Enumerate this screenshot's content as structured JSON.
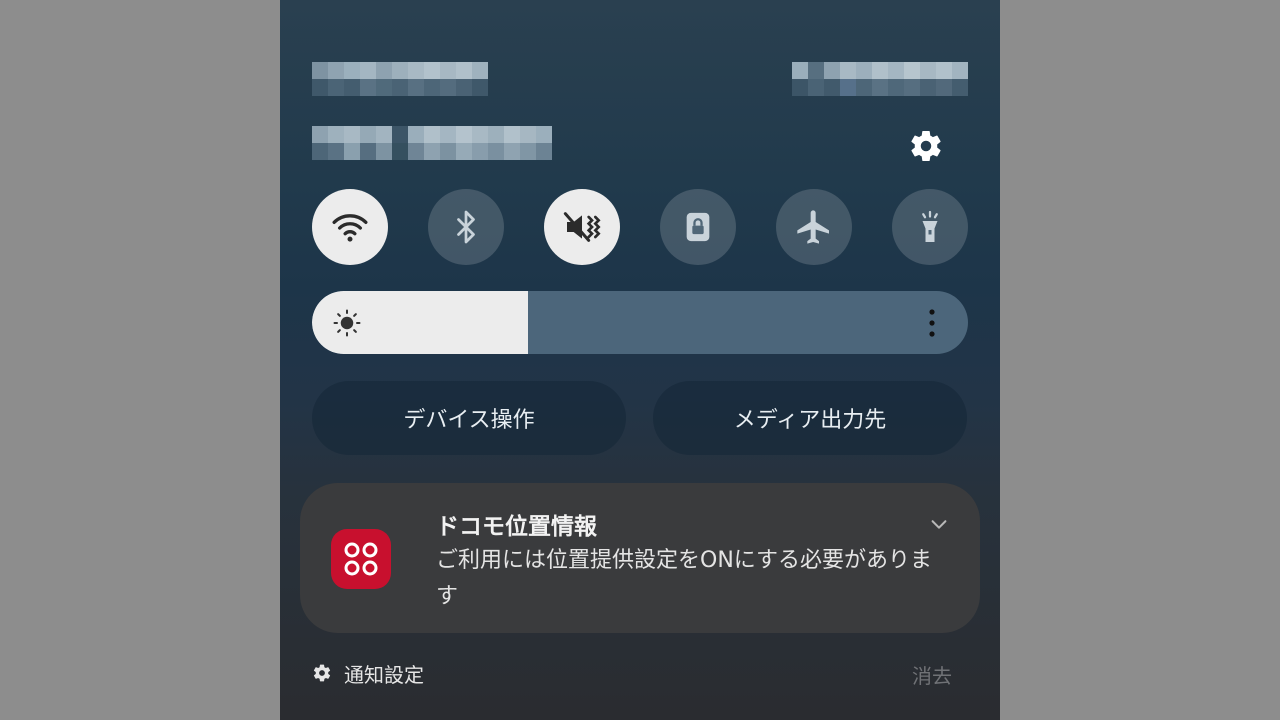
{
  "quick_settings": {
    "tiles": [
      {
        "name": "wifi",
        "icon": "wifi-icon",
        "active": true
      },
      {
        "name": "bluetooth",
        "icon": "bluetooth-icon",
        "active": false
      },
      {
        "name": "sound",
        "icon": "mute-vibrate-icon",
        "active": true
      },
      {
        "name": "rotation-lock",
        "icon": "lock-icon",
        "active": false
      },
      {
        "name": "airplane-mode",
        "icon": "airplane-icon",
        "active": false
      },
      {
        "name": "flashlight",
        "icon": "flashlight-icon",
        "active": false
      }
    ],
    "brightness_level": 0.33
  },
  "buttons": {
    "device_control": "デバイス操作",
    "media_output": "メディア出力先"
  },
  "notification": {
    "app_icon": "docomo-location-icon",
    "title": "ドコモ位置情報",
    "body": "ご利用には位置提供設定をONにする必要があります"
  },
  "footer": {
    "settings_label": "通知設定",
    "clear_label": "消去"
  },
  "colors": {
    "tile_active": "#ececec",
    "app_icon_bg": "#c8102e",
    "notification_bg": "#3a3b3d"
  }
}
